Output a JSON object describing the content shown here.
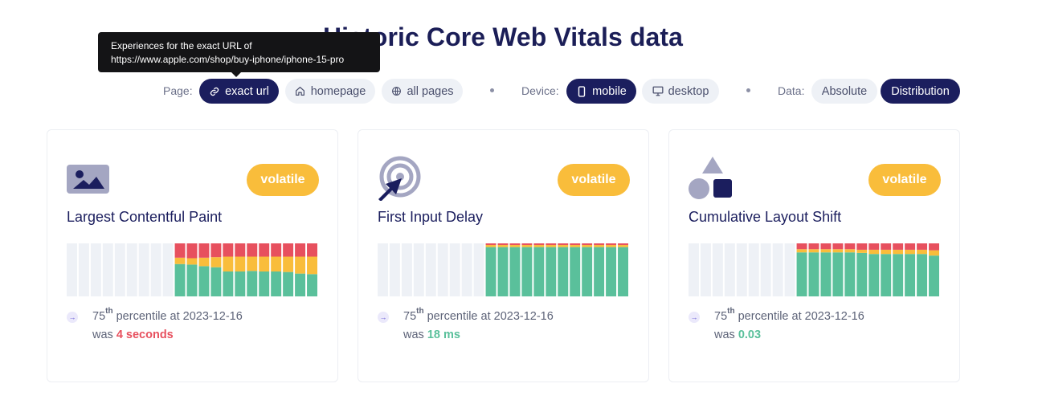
{
  "title": "Historic Core Web Vitals data",
  "tooltip": {
    "line1": "Experiences for the exact URL of",
    "line2": "https://www.apple.com/shop/buy-iphone/iphone-15-pro"
  },
  "filters": {
    "page_label": "Page:",
    "page_options": [
      {
        "label": "exact url",
        "icon": "link-icon",
        "active": true
      },
      {
        "label": "homepage",
        "icon": "home-icon",
        "active": false
      },
      {
        "label": "all pages",
        "icon": "globe-icon",
        "active": false
      }
    ],
    "device_label": "Device:",
    "device_options": [
      {
        "label": "mobile",
        "icon": "mobile-icon",
        "active": true
      },
      {
        "label": "desktop",
        "icon": "desktop-icon",
        "active": false
      }
    ],
    "data_label": "Data:",
    "data_options": [
      {
        "label": "Absolute",
        "active": false
      },
      {
        "label": "Distribution",
        "active": true
      }
    ]
  },
  "colors": {
    "good": "#5ac09b",
    "needs_improvement": "#f9bd3b",
    "poor": "#e7505e",
    "empty": "#eef1f6",
    "accent": "#1b1e5e"
  },
  "cards": [
    {
      "icon": "image-icon",
      "badge": "volatile",
      "title": "Largest Contentful Paint",
      "percentile_sup": "th",
      "percentile_num": "75",
      "percentile_text": " percentile at 2023-12-16",
      "was": "was ",
      "value": "4 seconds",
      "rating": "poor"
    },
    {
      "icon": "target-pointer-icon",
      "badge": "volatile",
      "title": "First Input Delay",
      "percentile_sup": "th",
      "percentile_num": "75",
      "percentile_text": " percentile at 2023-12-16",
      "was": "was ",
      "value": "18 ms",
      "rating": "good"
    },
    {
      "icon": "shapes-icon",
      "badge": "volatile",
      "title": "Cumulative Layout Shift",
      "percentile_sup": "th",
      "percentile_num": "75",
      "percentile_text": " percentile at 2023-12-16",
      "was": "was ",
      "value": "0.03",
      "rating": "good"
    }
  ],
  "chart_data": [
    {
      "type": "bar",
      "title": "Largest Contentful Paint",
      "stacked": true,
      "empty_periods": 9,
      "series": [
        {
          "values": [
            0.61,
            0.6,
            0.57,
            0.55,
            0.47,
            0.47,
            0.48,
            0.47,
            0.47,
            0.46,
            0.43,
            0.42
          ]
        },
        {
          "values": [
            0.12,
            0.12,
            0.16,
            0.19,
            0.28,
            0.28,
            0.27,
            0.28,
            0.28,
            0.29,
            0.32,
            0.33
          ]
        },
        {
          "values": [
            0.27,
            0.28,
            0.27,
            0.26,
            0.25,
            0.25,
            0.25,
            0.25,
            0.25,
            0.25,
            0.25,
            0.25
          ]
        }
      ]
    },
    {
      "type": "bar",
      "title": "First Input Delay",
      "stacked": true,
      "empty_periods": 9,
      "series": [
        {
          "values": [
            0.93,
            0.93,
            0.93,
            0.93,
            0.93,
            0.93,
            0.93,
            0.93,
            0.93,
            0.93,
            0.93,
            0.93
          ]
        },
        {
          "values": [
            0.04,
            0.04,
            0.04,
            0.04,
            0.04,
            0.04,
            0.04,
            0.04,
            0.04,
            0.04,
            0.04,
            0.04
          ]
        },
        {
          "values": [
            0.03,
            0.03,
            0.03,
            0.03,
            0.03,
            0.03,
            0.03,
            0.03,
            0.03,
            0.03,
            0.03,
            0.03
          ]
        }
      ]
    },
    {
      "type": "bar",
      "title": "Cumulative Layout Shift",
      "stacked": true,
      "empty_periods": 9,
      "series": [
        {
          "values": [
            0.83,
            0.83,
            0.83,
            0.83,
            0.83,
            0.82,
            0.8,
            0.8,
            0.8,
            0.8,
            0.8,
            0.77
          ]
        },
        {
          "values": [
            0.06,
            0.06,
            0.06,
            0.06,
            0.06,
            0.06,
            0.08,
            0.08,
            0.08,
            0.08,
            0.08,
            0.1
          ]
        },
        {
          "values": [
            0.11,
            0.11,
            0.11,
            0.11,
            0.11,
            0.12,
            0.12,
            0.12,
            0.12,
            0.12,
            0.12,
            0.13
          ]
        }
      ]
    }
  ]
}
